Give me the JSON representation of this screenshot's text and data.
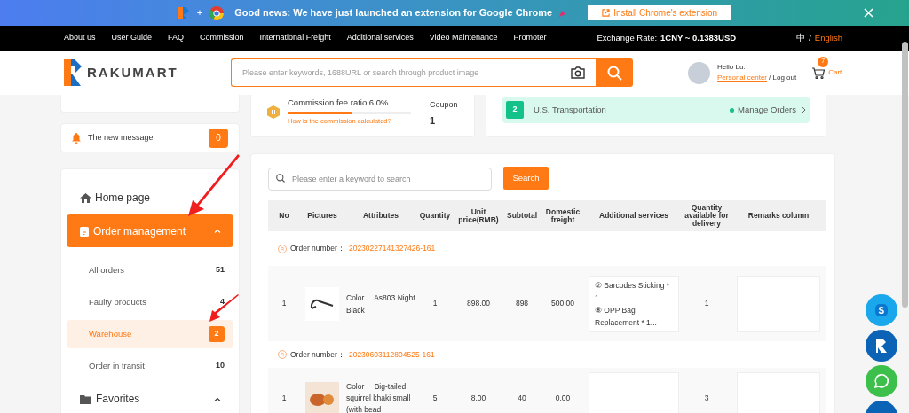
{
  "banner": {
    "message": "Good news: We have just launched an extension for Google Chrome",
    "button": "Install Chrome's extension",
    "joiner": "+"
  },
  "floating_chat": {
    "label": "S"
  },
  "nav": {
    "items": [
      "About us",
      "User Guide",
      "FAQ",
      "Commission",
      "International Freight",
      "Additional services",
      "Video Maintenance",
      "Promoter"
    ],
    "exchange_label": "Exchange Rate:",
    "exchange_value": "1CNY ~ 0.1383USD",
    "language_separator": "/",
    "languages": [
      {
        "label": "中",
        "selected": false
      },
      {
        "label": "English",
        "selected": true
      }
    ]
  },
  "header": {
    "logo": "RAKUMART",
    "search_placeholder": "Please enter keywords, 1688URL or search through product image",
    "greeting": "Hello Lu.",
    "personal_center": "Personal center",
    "logout": "/ Log out",
    "cart_count": "7",
    "cart_label": "Cart"
  },
  "sidebar": {
    "message": {
      "label": "The new message",
      "count": "0"
    },
    "menu": [
      {
        "kind": "link",
        "label": "Home page",
        "selected": false
      },
      {
        "kind": "group",
        "label": "Order management",
        "selected": true,
        "expanded": true,
        "children": [
          {
            "label": "All orders",
            "count": "51",
            "selected": false
          },
          {
            "label": "Faulty products",
            "count": "4",
            "selected": false
          },
          {
            "label": "Warehouse",
            "count": "2",
            "selected": true
          },
          {
            "label": "Order in transit",
            "count": "10",
            "selected": false
          }
        ]
      },
      {
        "kind": "group",
        "label": "Favorites",
        "selected": false,
        "expanded": true
      }
    ]
  },
  "commission": {
    "title": "Commission fee ratio 6.0%",
    "level": 0.52,
    "link": "How is the commission calculated?",
    "coupon_label": "Coupon",
    "coupon_value": "1"
  },
  "transport": {
    "step": "2",
    "label": "U.S. Transportation",
    "action": "Manage Orders"
  },
  "table": {
    "search_placeholder": "Please enter a keyword to search",
    "search_button": "Search",
    "columns": [
      "No",
      "Pictures",
      "Attributes",
      "Quantity",
      "Unit price(RMB)",
      "Subtotal",
      "Domestic freight",
      "Additional services",
      "Quantity available for delivery",
      "Remarks column"
    ],
    "orders": [
      {
        "label": "Order number：",
        "number": "20230227141327426-161",
        "rows": [
          {
            "no": "1",
            "attributes": "Color：  As803 Night Black",
            "quantity": "1",
            "unit_price": "898.00",
            "subtotal": "898",
            "freight": "500.00",
            "services": [
              "② Barcodes Sticking * 1",
              "⑧ OPP Bag Replacement * 1..."
            ],
            "deliverable": "1"
          }
        ]
      },
      {
        "label": "Order number：",
        "number": "20230603112804525-161",
        "rows": [
          {
            "no": "1",
            "attributes": "Color：  Big-tailed squirrel khaki small (with bead",
            "quantity": "5",
            "unit_price": "8.00",
            "subtotal": "40",
            "freight": "0.00",
            "deliverable": "3"
          }
        ]
      }
    ]
  }
}
